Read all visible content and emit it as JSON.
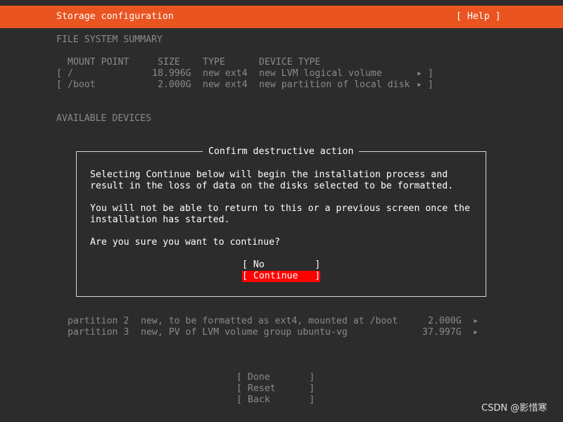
{
  "header": {
    "title": "Storage configuration",
    "help": "[ Help ]"
  },
  "fs_summary": {
    "heading": "FILE SYSTEM SUMMARY",
    "columns": [
      "MOUNT POINT",
      "SIZE",
      "TYPE",
      "DEVICE TYPE"
    ],
    "rows": [
      {
        "open": "[",
        "mount": "/",
        "size": "18.996G",
        "type": "new ext4",
        "device": "new LVM logical volume",
        "arrow": "▸",
        "close": "]"
      },
      {
        "open": "[",
        "mount": "/boot",
        "size": "2.000G",
        "type": "new ext4",
        "device": "new partition of local disk",
        "arrow": "▸",
        "close": "]"
      }
    ]
  },
  "available": {
    "heading": "AVAILABLE DEVICES",
    "partitions": [
      {
        "name": "partition 2",
        "desc": "new, to be formatted as ext4, mounted at /boot",
        "size": "2.000G",
        "arrow": "▸"
      },
      {
        "name": "partition 3",
        "desc": "new, PV of LVM volume group ubuntu-vg",
        "size": "37.997G",
        "arrow": "▸"
      }
    ]
  },
  "dialog": {
    "title": "Confirm destructive action",
    "para1_line1": "Selecting Continue below will begin the installation process and",
    "para1_line2": "result in the loss of data on the disks selected to be formatted.",
    "para2_line1": "You will not be able to return to this or a previous screen once the",
    "para2_line2": "installation has started.",
    "question": "Are you sure you want to continue?",
    "no_label": "[ No         ]",
    "continue_label": "[ Continue   ]"
  },
  "footer": {
    "done_label": "[ Done       ]",
    "reset_label": "[ Reset      ]",
    "back_label": "[ Back       ]"
  },
  "watermark": "CSDN @影惜寒",
  "colors": {
    "header_bg": "#e95420",
    "background": "#2c2c2c",
    "focus_button": "#ff0000"
  }
}
